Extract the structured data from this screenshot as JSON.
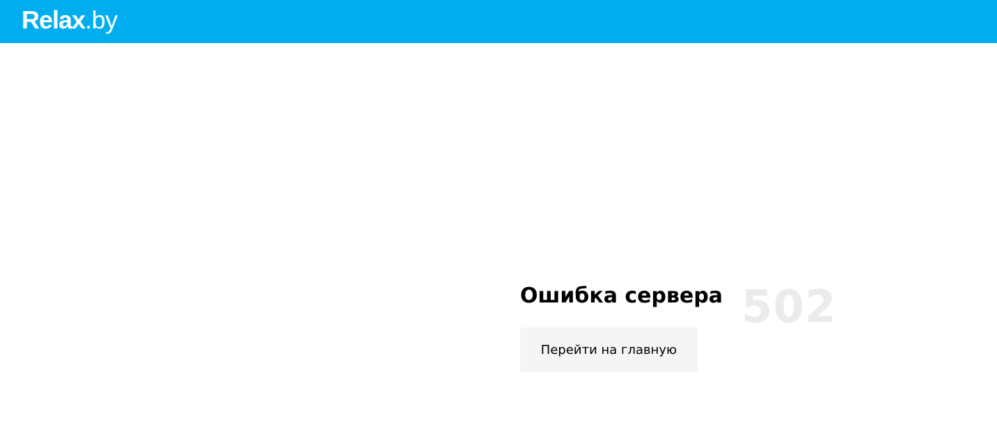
{
  "header": {
    "logo": {
      "brand": "Relax",
      "tld": ".by"
    },
    "background_color": "#00aeef"
  },
  "error": {
    "title": "Ошибка сервера",
    "code": "502",
    "home_button_label": "Перейти на главную"
  }
}
